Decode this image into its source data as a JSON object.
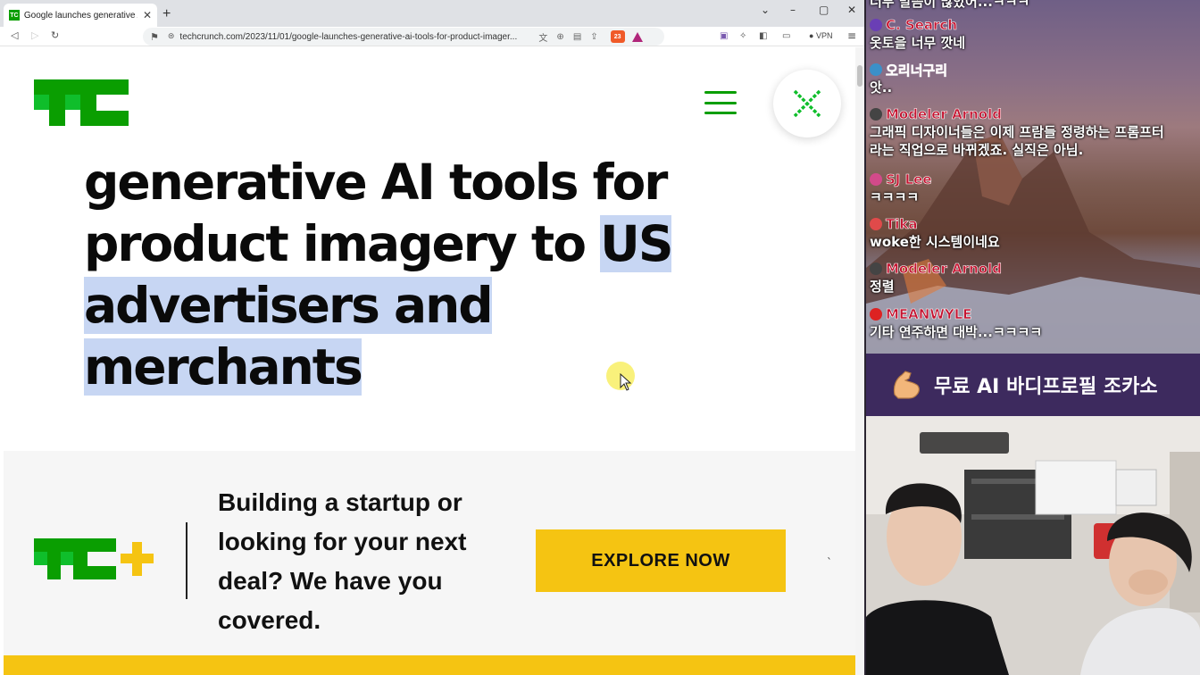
{
  "browser": {
    "tab_title": "Google launches generative AI t",
    "tab_favicon": "TC",
    "new_tab": "+",
    "url": "techcrunch.com/2023/11/01/google-launches-generative-ai-tools-for-product-imager...",
    "shields_count": "23",
    "vpn_label": "VPN"
  },
  "page": {
    "headline_lines": [
      {
        "plain": "generative AI tools for",
        "hl": ""
      },
      {
        "plain": "product imagery to ",
        "hl": "US"
      },
      {
        "plain": "",
        "hl": "advertisers and"
      },
      {
        "plain": "",
        "hl": "merchants"
      }
    ],
    "brand_color": "#0a9e01",
    "promo": {
      "text": "Building a startup or looking for your next deal? We have you covered.",
      "button_label": "EXPLORE NOW",
      "mark": "`"
    }
  },
  "overlay": {
    "chat": [
      {
        "name": "",
        "message": "너무 말씀이 많았어...ㅋㅋㅋ",
        "badge": ""
      },
      {
        "name": "C. Search",
        "message": "옷토을 너무 깟네",
        "badge": "#6a3fb5"
      },
      {
        "name": "오리너구리",
        "message": "앗..",
        "badge": "#3b90c9"
      },
      {
        "name": "Modeler Arnold",
        "message": "그래픽 디자이너들은 이제 프람들 정령하는 프롬프터",
        "message2": "라는 직업으로 바뀌겠죠. 실직은 아님.",
        "badge": "#444444"
      },
      {
        "name": "SJ Lee",
        "message": "ㅋㅋㅋㅋ",
        "badge": "#d24a8a"
      },
      {
        "name": "Tika",
        "message": "woke한 시스템이네요",
        "badge": "#e04a4a"
      },
      {
        "name": "Modeler Arnold",
        "message": "정렬",
        "badge": "#444444"
      },
      {
        "name": "MEANWYLE",
        "message": "기타 연주하면 대박...ㅋㅋㅋㅋ",
        "badge": "#d22"
      }
    ],
    "banner": "무료 AI 바디프로필 조카소"
  }
}
